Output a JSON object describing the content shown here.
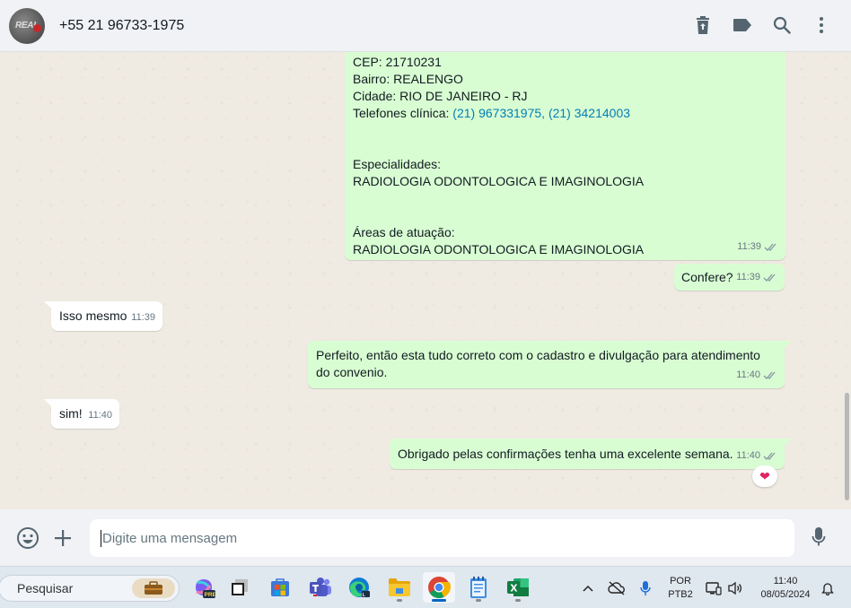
{
  "header": {
    "avatar_text": "REAL",
    "contact_name": "+55 21 96733-1975",
    "icons": [
      "trash-icon",
      "label-icon",
      "search-icon",
      "menu-icon"
    ]
  },
  "messages": {
    "clinic_info": {
      "cep": "CEP: 21710231",
      "bairro": "Bairro: REALENGO",
      "cidade": "Cidade: RIO DE JANEIRO - RJ",
      "telefones_label": "Telefones clínica: ",
      "telefones_value": "(21) 967331975, (21) 34214003",
      "especialidades_label": "Especialidades:",
      "especialidades_value": "RADIOLOGIA ODONTOLOGICA E IMAGINOLOGIA",
      "areas_label": "Áreas de atuação:",
      "areas_value": "RADIOLOGIA ODONTOLOGICA E IMAGINOLOGIA",
      "time": "11:39"
    },
    "confere": {
      "text": "Confere?",
      "time": "11:39"
    },
    "isso_mesmo": {
      "text": "Isso mesmo",
      "time": "11:39"
    },
    "perfeito": {
      "text": "Perfeito, então esta tudo correto com o cadastro e divulgação para atendimento do convenio.",
      "time": "11:40"
    },
    "sim": {
      "text": "sim!",
      "time": "11:40"
    },
    "obrigado": {
      "text": "Obrigado pelas confirmações tenha uma excelente semana.",
      "time": "11:40",
      "reaction": "❤"
    }
  },
  "composer": {
    "placeholder": "Digite uma mensagem"
  },
  "taskbar": {
    "search_label": "Pesquisar",
    "language_line1": "POR",
    "language_line2": "PTB2",
    "clock_time": "11:40",
    "clock_date": "08/05/2024"
  },
  "colors": {
    "outgoing_bubble": "#d9fdd3",
    "incoming_bubble": "#ffffff",
    "chat_background": "#efeae2",
    "link": "#027eb5",
    "header_bg": "#f0f2f5"
  }
}
